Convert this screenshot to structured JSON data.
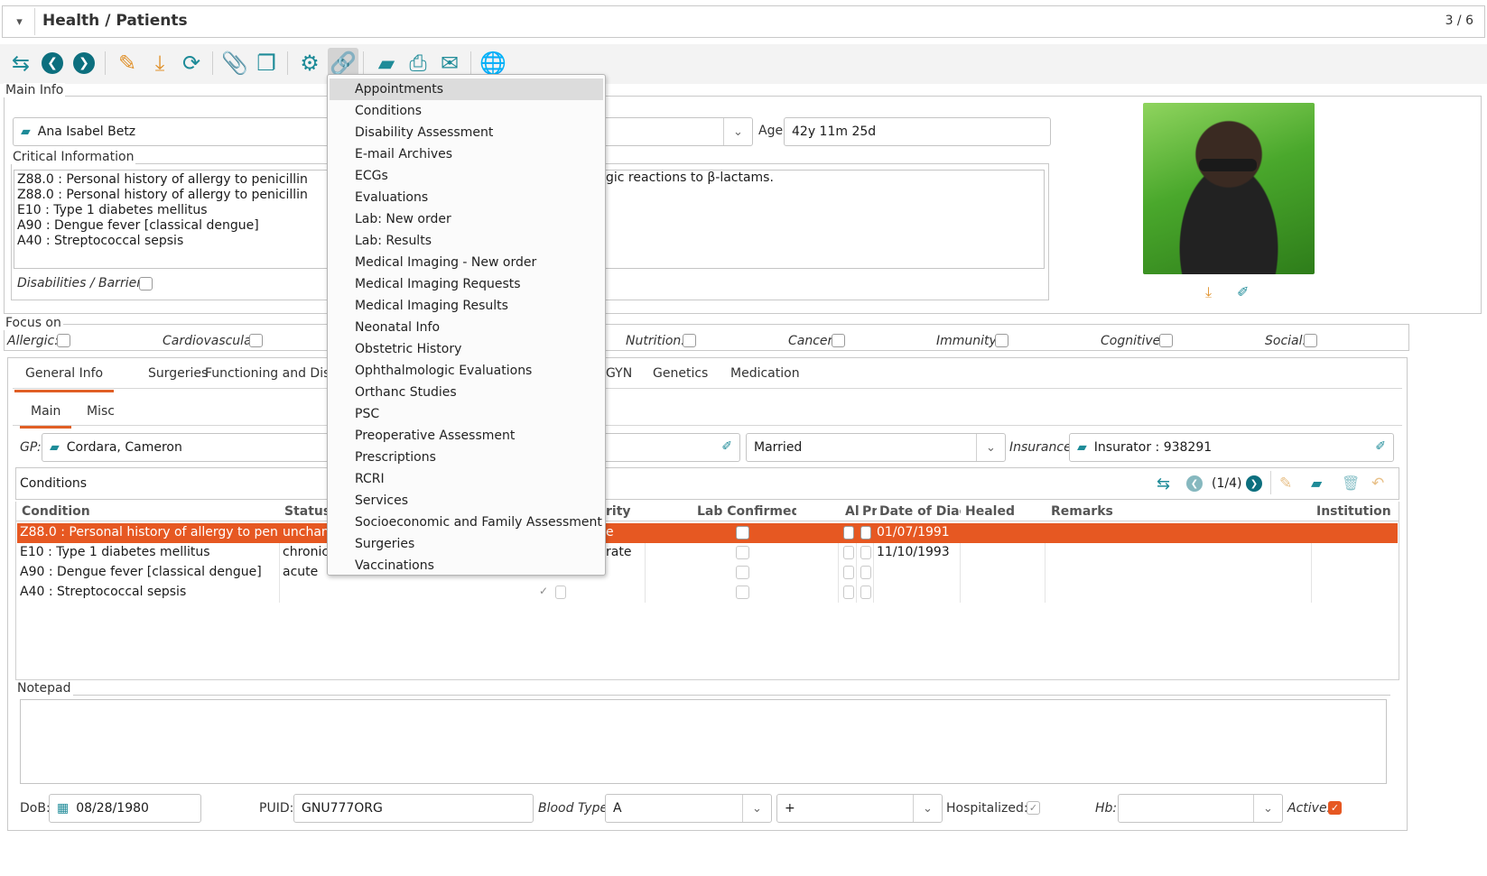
{
  "header": {
    "title": "Health / Patients",
    "record_counter": "3 / 6"
  },
  "toolbar": {
    "icons": [
      "switch-view-icon",
      "previous-record-icon",
      "next-record-icon",
      "edit-icon",
      "import-icon",
      "reload-icon",
      "attachment-icon",
      "notes-icon",
      "action-gear-icon",
      "relate-link-icon",
      "open-folder-icon",
      "print-icon",
      "email-icon",
      "web-globe-icon"
    ]
  },
  "main_info": {
    "legend": "Main Info",
    "patient_name": "Ana Isabel Betz",
    "age_label": "Age:",
    "age_value": "42y 11m 25d"
  },
  "critical": {
    "legend": "Critical Information",
    "lines": [
      "Z88.0 : Personal history of allergy to penicillin",
      "Z88.0 : Personal history of allergy to penicillin",
      "E10 : Type 1 diabetes mellitus",
      "A90 : Dengue fever [classical dengue]",
      "A40 : Streptococcal sepsis"
    ],
    "extra_note": "gic reactions to β-lactams.",
    "disabilities_label": "Disabilities / Barriers:"
  },
  "focus": {
    "legend": "Focus on",
    "items": [
      "Allergic:",
      "Cardiovascular:",
      "Nutrition:",
      "Cancer:",
      "Immunity:",
      "Cognitive:",
      "Social:"
    ]
  },
  "tabs": [
    "General Info",
    "Surgeries",
    "Functioning and Disab",
    "GYN",
    "Genetics",
    "Medication"
  ],
  "subtabs": [
    "Main",
    "Misc"
  ],
  "general": {
    "gp_label": "GP:",
    "gp_value": "Cordara, Cameron",
    "marital_status": "Married",
    "insurance_label": "Insurance:",
    "insurance_value": "Insurator : 938291"
  },
  "conditions": {
    "title": "Conditions",
    "pager": "(1/4)",
    "headers": [
      "Condition",
      "Status",
      "rity",
      "Lab Confirmed",
      "Al",
      "Pr",
      "Date of Diagr",
      "Healed",
      "Remarks",
      "Institution"
    ],
    "rows": [
      {
        "condition": "Z88.0 : Personal history of allergy to penicillin",
        "status": "unchang",
        "severity": "e",
        "date": "01/07/1991",
        "selected": true
      },
      {
        "condition": "E10 : Type 1 diabetes mellitus",
        "status": "chronic",
        "severity": "rate",
        "date": "11/10/1993",
        "selected": false
      },
      {
        "condition": "A90 : Dengue fever [classical dengue]",
        "status": "acute",
        "severity": "",
        "date": "",
        "selected": false
      },
      {
        "condition": "A40 : Streptococcal sepsis",
        "status": "",
        "severity": "",
        "date": "",
        "selected": false
      }
    ]
  },
  "notepad": {
    "legend": "Notepad"
  },
  "footer": {
    "dob_label": "DoB:",
    "dob_value": "08/28/1980",
    "puid_label": "PUID:",
    "puid_value": "GNU777ORG",
    "blood_label": "Blood Type:",
    "blood_value": "A",
    "rh_value": "+",
    "hosp_label": "Hospitalized:",
    "hb_label": "Hb:",
    "hb_value": "",
    "active_label": "Active:"
  },
  "popup_menu": {
    "items": [
      "Appointments",
      "Conditions",
      "Disability Assessment",
      "E-mail Archives",
      "ECGs",
      "Evaluations",
      "Lab: New order",
      "Lab: Results",
      "Medical Imaging - New order",
      "Medical Imaging Requests",
      "Medical Imaging Results",
      "Neonatal Info",
      "Obstetric History",
      "Ophthalmologic Evaluations",
      "Orthanc Studies",
      "PSC",
      "Preoperative Assessment",
      "Prescriptions",
      "RCRI",
      "Services",
      "Socioeconomic and Family Assessment",
      "Surgeries",
      "Vaccinations"
    ],
    "highlighted": "Appointments"
  },
  "colors": {
    "accent": "#e65822",
    "teal": "#1e8b98",
    "selection": "#e65822"
  }
}
